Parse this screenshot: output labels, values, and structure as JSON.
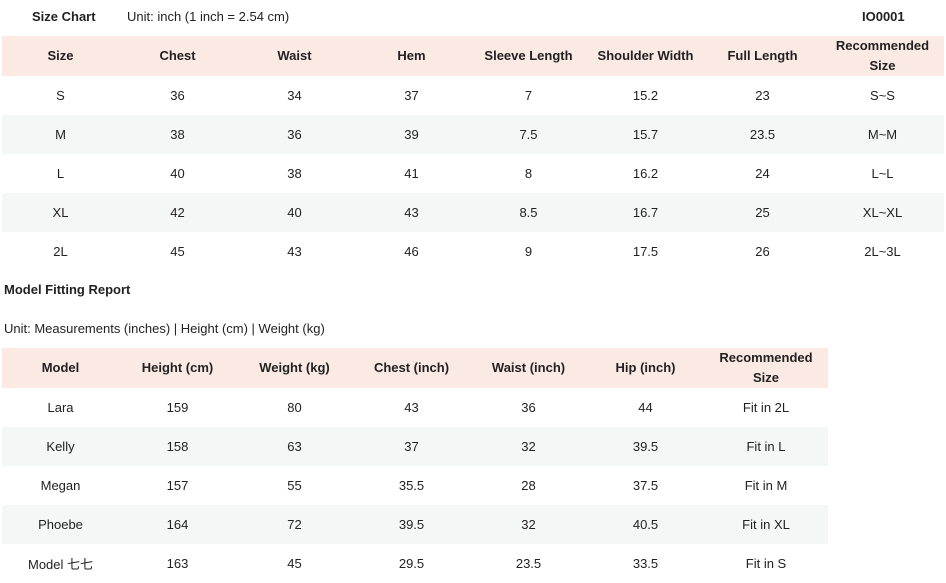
{
  "size_chart": {
    "title": "Size Chart",
    "unit_note": "Unit: inch (1 inch = 2.54 cm)",
    "product_code": "IO0001",
    "headers": [
      "Size",
      "Chest",
      "Waist",
      "Hem",
      "Sleeve Length",
      "Shoulder Width",
      "Full Length",
      "Recommended Size"
    ],
    "rows": [
      [
        "S",
        "36",
        "34",
        "37",
        "7",
        "15.2",
        "23",
        "S~S"
      ],
      [
        "M",
        "38",
        "36",
        "39",
        "7.5",
        "15.7",
        "23.5",
        "M~M"
      ],
      [
        "L",
        "40",
        "38",
        "41",
        "8",
        "16.2",
        "24",
        "L~L"
      ],
      [
        "XL",
        "42",
        "40",
        "43",
        "8.5",
        "16.7",
        "25",
        "XL~XL"
      ],
      [
        "2L",
        "45",
        "43",
        "46",
        "9",
        "17.5",
        "26",
        "2L~3L"
      ]
    ]
  },
  "model_fitting": {
    "title": "Model Fitting Report",
    "unit_note": "Unit: Measurements (inches) | Height (cm) | Weight (kg)",
    "headers": [
      "Model",
      "Height (cm)",
      "Weight (kg)",
      "Chest (inch)",
      "Waist (inch)",
      "Hip (inch)",
      "Recommended Size"
    ],
    "rows": [
      [
        "Lara",
        "159",
        "80",
        "43",
        "36",
        "44",
        "Fit in 2L"
      ],
      [
        "Kelly",
        "158",
        "63",
        "37",
        "32",
        "39.5",
        "Fit in L"
      ],
      [
        "Megan",
        "157",
        "55",
        "35.5",
        "28",
        "37.5",
        "Fit in M"
      ],
      [
        "Phoebe",
        "164",
        "72",
        "39.5",
        "32",
        "40.5",
        "Fit in XL"
      ],
      [
        "Model 七七",
        "163",
        "45",
        "29.5",
        "23.5",
        "33.5",
        "Fit in S"
      ]
    ]
  },
  "colors": {
    "header_bg": "#fbe9e3",
    "alt_row_bg": "#f3f7f5"
  }
}
